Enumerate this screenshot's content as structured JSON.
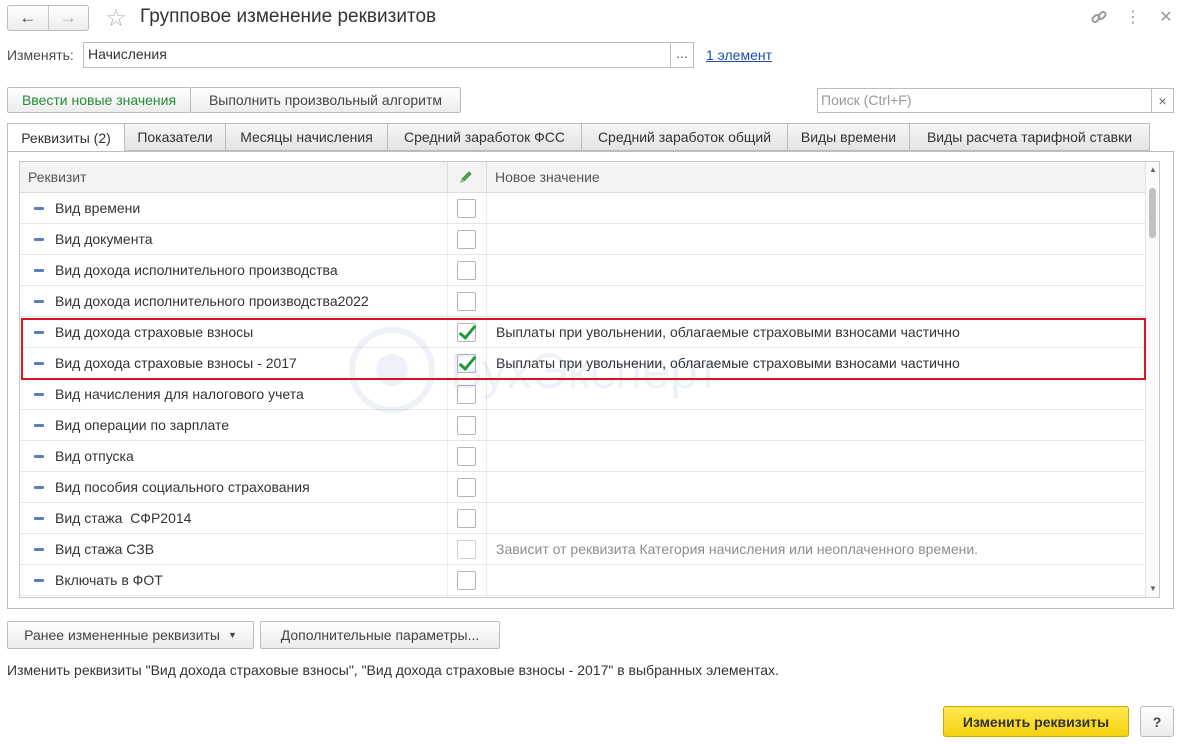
{
  "window": {
    "title": "Групповое изменение реквизитов",
    "back_icon": "arrow-left-icon",
    "forward_icon": "arrow-right-icon",
    "favorite_icon": "star-icon",
    "link_icon": "link-icon",
    "more_icon": "more-vertical-icon",
    "close_icon": "close-icon"
  },
  "edit_field": {
    "label": "Изменять:",
    "value": "Начисления",
    "select_button": "...",
    "elements_link": "1 элемент"
  },
  "toolbar": {
    "enter_values": "Ввести новые значения",
    "run_algorithm": "Выполнить произвольный алгоритм",
    "search_placeholder": "Поиск (Ctrl+F)",
    "search_clear": "×"
  },
  "tabs": [
    {
      "label": "Реквизиты (2)",
      "active": true
    },
    {
      "label": "Показатели",
      "active": false
    },
    {
      "label": "Месяцы начисления",
      "active": false
    },
    {
      "label": "Средний заработок ФСС",
      "active": false
    },
    {
      "label": "Средний заработок общий",
      "active": false
    },
    {
      "label": "Виды времени",
      "active": false
    },
    {
      "label": "Виды расчета тарифной ставки",
      "active": false
    }
  ],
  "table": {
    "columns": {
      "attribute": "Реквизит",
      "edit_icon": "pencil-icon",
      "new_value": "Новое значение"
    },
    "rows": [
      {
        "name": "Вид времени",
        "checked": false,
        "value": ""
      },
      {
        "name": "Вид документа",
        "checked": false,
        "value": ""
      },
      {
        "name": "Вид дохода исполнительного производства",
        "checked": false,
        "value": ""
      },
      {
        "name": "Вид дохода исполнительного производства2022",
        "checked": false,
        "value": ""
      },
      {
        "name": "Вид дохода страховые взносы",
        "checked": true,
        "value": "Выплаты при увольнении, облагаемые страховыми взносами частично"
      },
      {
        "name": "Вид дохода страховые взносы - 2017",
        "checked": true,
        "value": "Выплаты при увольнении, облагаемые страховыми взносами частично"
      },
      {
        "name": "Вид начисления для налогового учета",
        "checked": false,
        "value": ""
      },
      {
        "name": "Вид операции по зарплате",
        "checked": false,
        "value": ""
      },
      {
        "name": "Вид отпуска",
        "checked": false,
        "value": ""
      },
      {
        "name": "Вид пособия социального страхования",
        "checked": false,
        "value": ""
      },
      {
        "name": "Вид стажа  СФР2014",
        "checked": false,
        "value": ""
      },
      {
        "name": "Вид стажа СЗВ",
        "checked": false,
        "value": "Зависит от реквизита Категория начисления или неоплаченного времени.",
        "hint": true
      },
      {
        "name": "Включать в ФОТ",
        "checked": false,
        "value": ""
      }
    ]
  },
  "watermark": "БухЭксперт",
  "bottom": {
    "previous_changes": "Ранее измененные реквизиты",
    "previous_changes_icon": "dropdown-arrow-icon",
    "extra_params": "Дополнительные параметры...",
    "status": "Изменить реквизиты \"Вид дохода страховые взносы\", \"Вид дохода страховые взносы - 2017\" в выбранных элементах.",
    "apply": "Изменить реквизиты",
    "help": "?"
  },
  "colors": {
    "accent_green": "#238b3a",
    "highlight_red": "#d9141f",
    "apply_yellow": "#f5d10e",
    "link_blue": "#1a4fa8"
  }
}
